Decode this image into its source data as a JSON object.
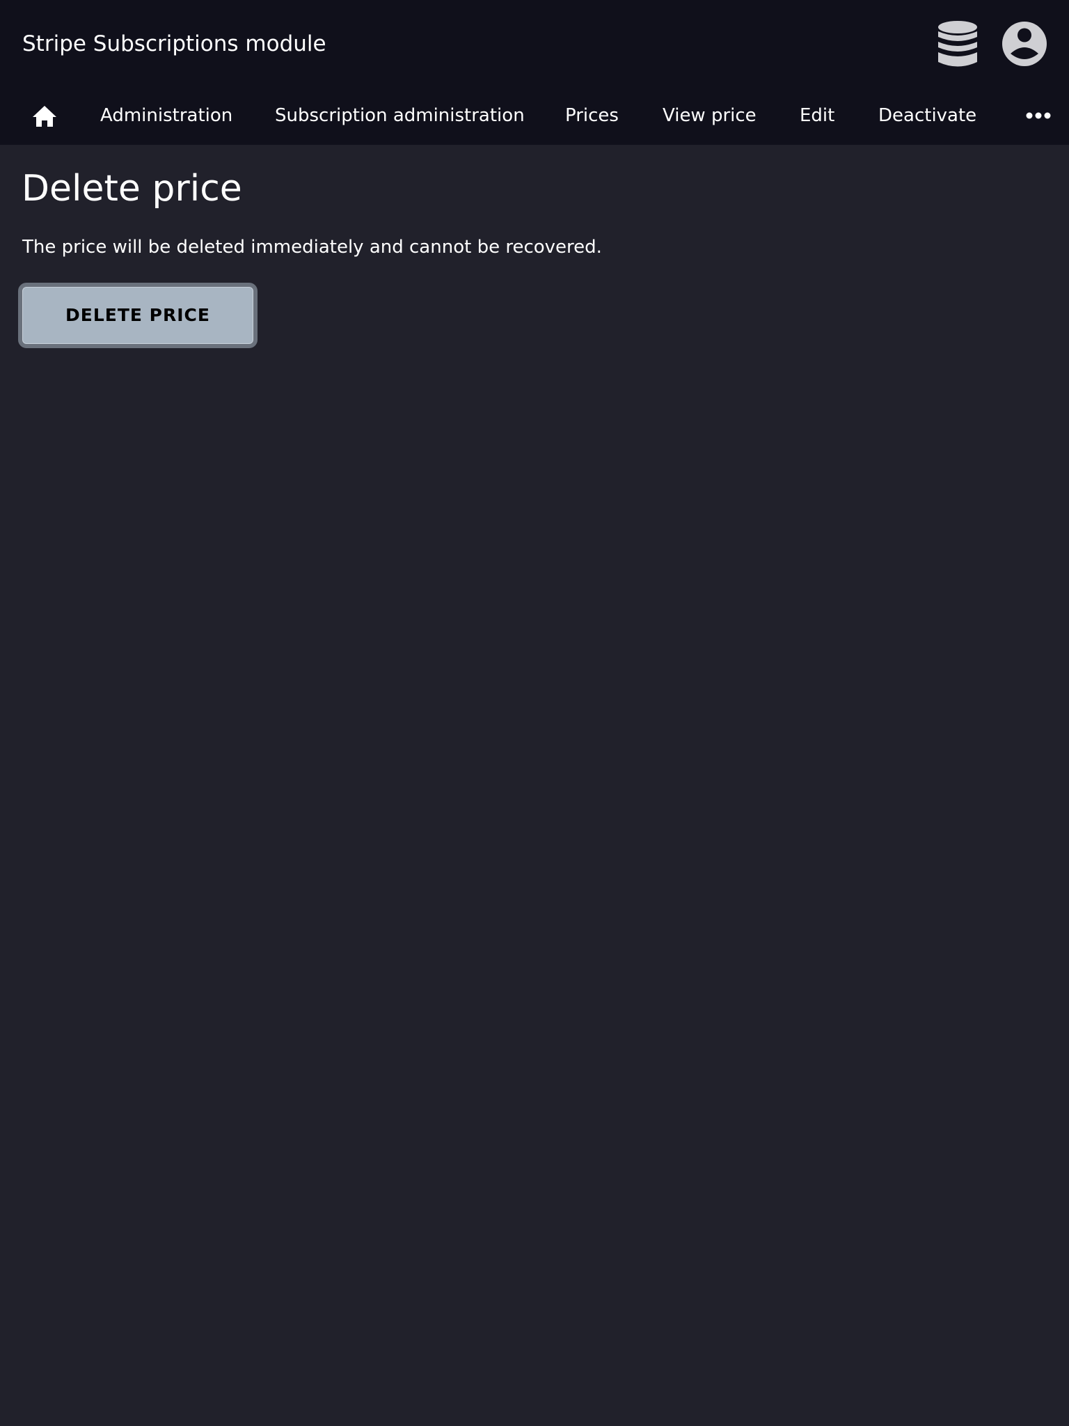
{
  "header": {
    "title": "Stripe Subscriptions module",
    "icons": {
      "database": "database-icon",
      "user": "user-account-icon"
    }
  },
  "nav": {
    "home_icon": "home-icon",
    "items": [
      {
        "label": "Administration"
      },
      {
        "label": "Subscription administration"
      },
      {
        "label": "Prices"
      },
      {
        "label": "View price"
      },
      {
        "label": "Edit"
      },
      {
        "label": "Deactivate"
      }
    ],
    "more_icon": "more-horizontal-icon"
  },
  "main": {
    "title": "Delete price",
    "message": "The price will be deleted immediately and cannot be recovered.",
    "delete_button_label": "DELETE PRICE"
  },
  "colors": {
    "header_bg": "#10101b",
    "page_bg": "#21212b",
    "button_bg": "#a8b5c2",
    "button_border": "#6a717c",
    "icon_gray": "#cfcfd3"
  }
}
